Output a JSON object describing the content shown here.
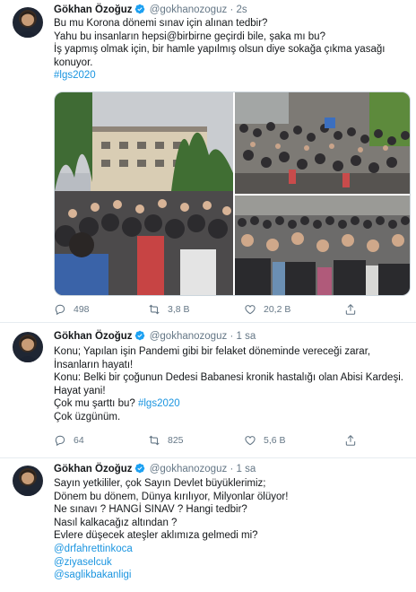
{
  "tweets": [
    {
      "name": "Gökhan Özoğuz",
      "handle": "@gokhanozoguz",
      "separator": "·",
      "time": "2s",
      "lines": [
        "Bu mu Korona dönemi sınav için alınan tedbir?",
        "Yahu bu insanların hepsi@birbirne geçirdi bile, şaka mı bu?",
        "İş yapmış olmak için, bir hamle yapılmış olsun diye sokağa çıkma yasağı",
        "konuyor."
      ],
      "hashtag": "#lgs2020",
      "stats": {
        "replies": "498",
        "retweets": "3,8 B",
        "likes": "20,2 B"
      }
    },
    {
      "name": "Gökhan Özoğuz",
      "handle": "@gokhanozoguz",
      "separator": "·",
      "time": "1 sa",
      "lines": [
        "Konu; Yapılan işin Pandemi gibi bir felaket döneminde vereceği zarar,",
        "İnsanların hayatı!",
        "Konu: Belki bir çoğunun Dedesi Babanesi kronik hastalığı olan Abisi Kardeşi.",
        "Hayat yani!"
      ],
      "line_with_tag_prefix": "Çok mu şarttı bu? ",
      "hashtag": "#lgs2020",
      "last_line": "Çok üzgünüm.",
      "stats": {
        "replies": "64",
        "retweets": "825",
        "likes": "5,6 B"
      }
    },
    {
      "name": "Gökhan Özoğuz",
      "handle": "@gokhanozoguz",
      "separator": "·",
      "time": "1 sa",
      "lines": [
        "Sayın yetkililer, çok Sayın Devlet büyüklerimiz;",
        "Dönem bu dönem, Dünya kırılıyor, Milyonlar ölüyor!",
        "Ne sınavı ? HANGİ SINAV ? Hangi tedbir?",
        "Nasıl kalkacağız altından ?",
        "Evlere düşecek ateşler aklımıza gelmedi mi?"
      ],
      "mentions": [
        "@drfahrettinkoca",
        "@ziyaselcuk",
        "@saglikbakanligi"
      ]
    }
  ],
  "icons": {
    "reply": "reply-icon",
    "retweet": "retweet-icon",
    "like": "heart-icon",
    "share": "share-icon",
    "verified": "verified-badge-icon"
  },
  "colors": {
    "link": "#1b95e0",
    "muted": "#657786",
    "verified": "#1da1f2"
  }
}
